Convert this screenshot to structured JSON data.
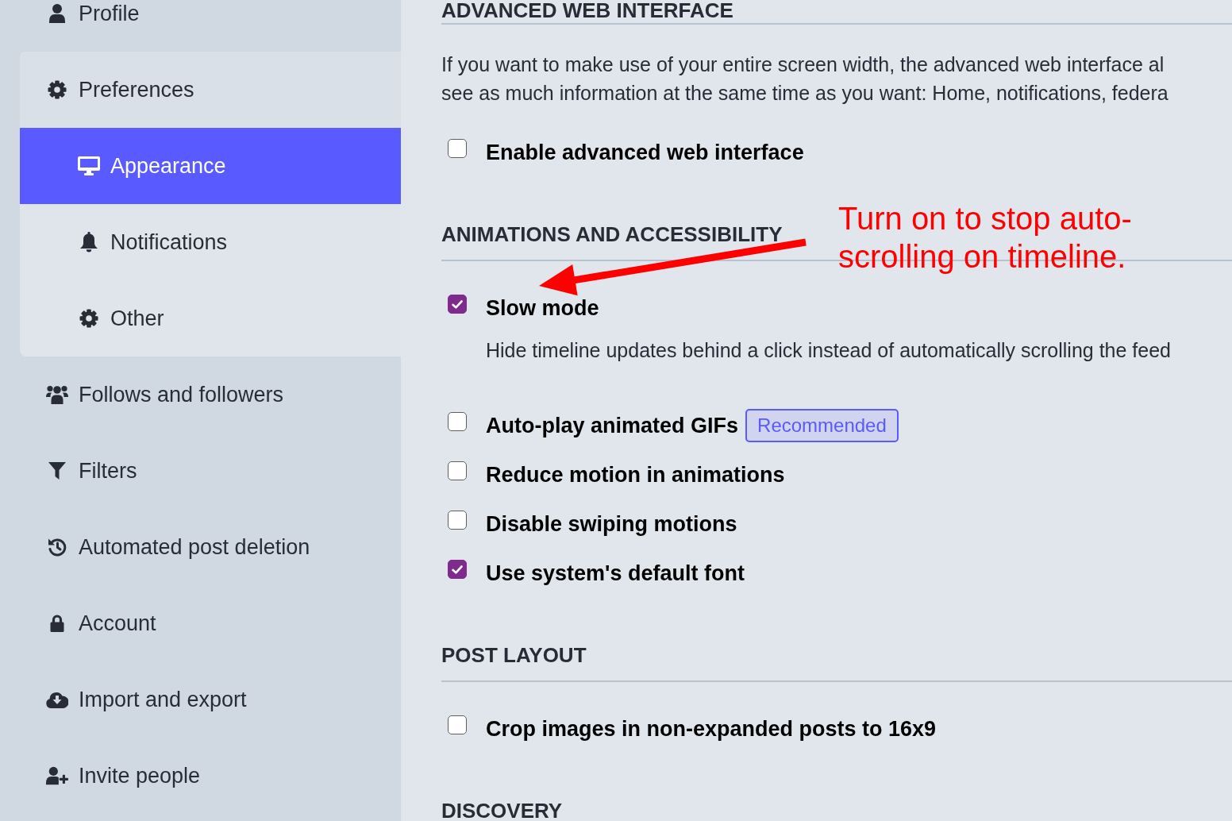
{
  "sidebar": {
    "items": [
      {
        "label": "Profile",
        "selected": false
      },
      {
        "label": "Preferences",
        "selected": false,
        "expanded": true,
        "children": [
          {
            "label": "Appearance",
            "selected": true
          },
          {
            "label": "Notifications",
            "selected": false
          },
          {
            "label": "Other",
            "selected": false
          }
        ]
      },
      {
        "label": "Follows and followers",
        "selected": false
      },
      {
        "label": "Filters",
        "selected": false
      },
      {
        "label": "Automated post deletion",
        "selected": false
      },
      {
        "label": "Account",
        "selected": false
      },
      {
        "label": "Import and export",
        "selected": false
      },
      {
        "label": "Invite people",
        "selected": false
      }
    ]
  },
  "sections": [
    {
      "heading": "ADVANCED WEB INTERFACE",
      "description_lines": [
        "If you want to make use of your entire screen width, the advanced web interface al",
        "see as much information at the same time as you want: Home, notifications, federa"
      ],
      "options": [
        {
          "label": "Enable advanced web interface",
          "checked": false
        }
      ]
    },
    {
      "heading": "ANIMATIONS AND ACCESSIBILITY",
      "options": [
        {
          "label": "Slow mode",
          "checked": true,
          "hint": "Hide timeline updates behind a click instead of automatically scrolling the feed"
        },
        {
          "label": "Auto-play animated GIFs",
          "checked": false,
          "badge": "Recommended"
        },
        {
          "label": "Reduce motion in animations",
          "checked": false
        },
        {
          "label": "Disable swiping motions",
          "checked": false
        },
        {
          "label": "Use system's default font",
          "checked": true
        }
      ]
    },
    {
      "heading": "POST LAYOUT",
      "options": [
        {
          "label": "Crop images in non-expanded posts to 16x9",
          "checked": false
        }
      ]
    },
    {
      "heading": "DISCOVERY"
    }
  ],
  "annotation": {
    "lines": [
      "Turn on to stop auto-",
      "scrolling on timeline."
    ]
  }
}
